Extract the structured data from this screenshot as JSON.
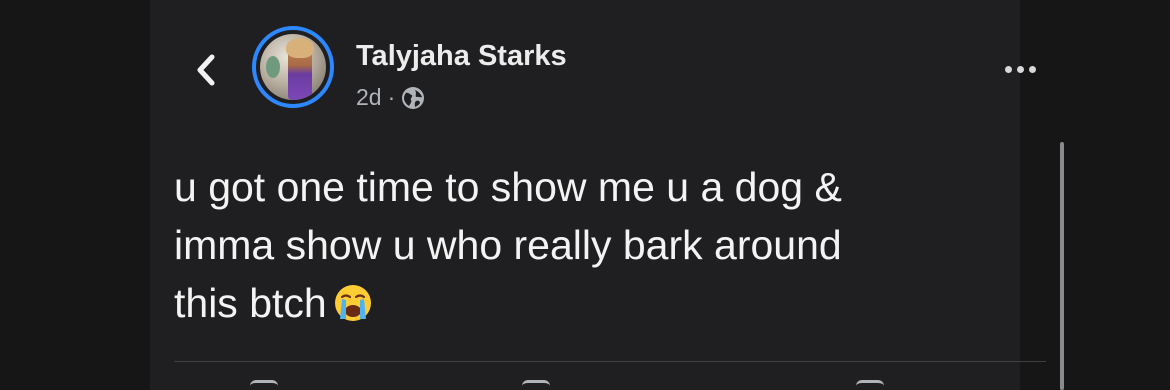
{
  "post": {
    "author": {
      "name": "Talyjaha Starks",
      "avatar_icon": "profile-photo",
      "story_ring_color": "#2d88ff"
    },
    "meta": {
      "time": "2d",
      "separator": "·",
      "audience_icon": "globe-icon"
    },
    "text_lines": [
      "u got one time to show me u a dog &",
      "imma show u who really bark around",
      "this btch"
    ],
    "text_emoji": "loudly-crying-face-emoji"
  },
  "nav": {
    "back_icon": "chevron-left-icon",
    "more_icon": "more-horizontal-icon"
  },
  "colors": {
    "background": "#1f1f21",
    "text_primary": "#f3f3f3",
    "text_secondary": "#b0b3b8",
    "accent": "#2d88ff",
    "divider": "#3e4042"
  }
}
